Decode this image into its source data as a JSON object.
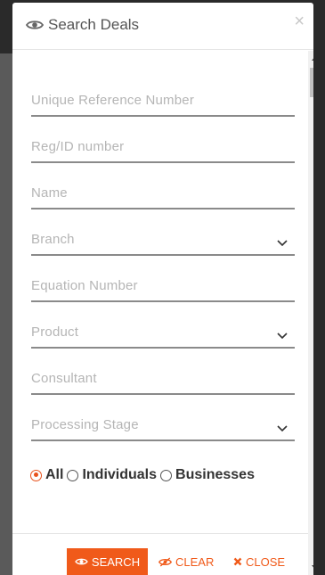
{
  "modal": {
    "title": "Search Deals",
    "close_glyph": "×",
    "title_icon": "eye-icon"
  },
  "fields": [
    {
      "label": "Unique Reference Number",
      "type": "text"
    },
    {
      "label": "Reg/ID number",
      "type": "text"
    },
    {
      "label": "Name",
      "type": "text"
    },
    {
      "label": "Branch",
      "type": "select"
    },
    {
      "label": "Equation Number",
      "type": "text"
    },
    {
      "label": "Product",
      "type": "select"
    },
    {
      "label": "Consultant",
      "type": "text"
    },
    {
      "label": "Processing Stage",
      "type": "select"
    }
  ],
  "radios": [
    {
      "label": "All",
      "checked": true
    },
    {
      "label": "Individuals",
      "checked": false
    },
    {
      "label": "Businesses",
      "checked": false
    }
  ],
  "footer": {
    "search_label": "SEARCH",
    "clear_label": "CLEAR",
    "close_label": "CLOSE"
  },
  "colors": {
    "accent": "#f05a1a",
    "label": "#b5b5b5",
    "underline": "#8a8a8a"
  }
}
